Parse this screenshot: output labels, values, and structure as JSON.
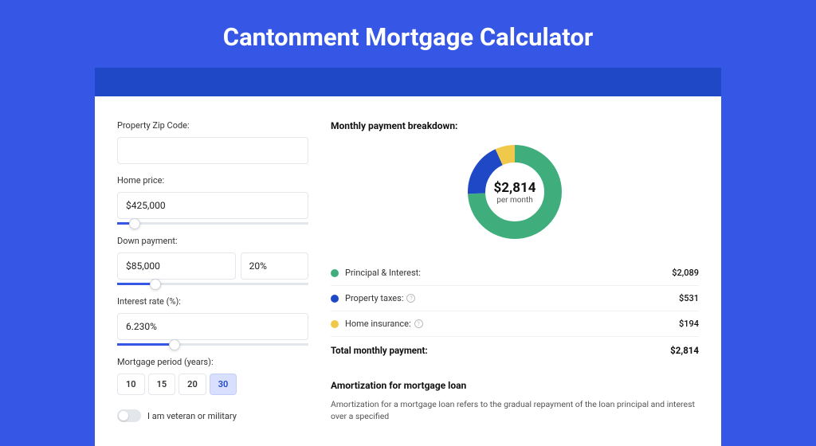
{
  "title": "Cantonment Mortgage Calculator",
  "form": {
    "zip": {
      "label": "Property Zip Code:",
      "value": ""
    },
    "homePrice": {
      "label": "Home price:",
      "value": "$425,000",
      "sliderPercent": 9
    },
    "downPayment": {
      "label": "Down payment:",
      "amount": "$85,000",
      "percent": "20%",
      "sliderPercent": 20
    },
    "interestRate": {
      "label": "Interest rate (%):",
      "value": "6.230%",
      "sliderPercent": 30
    },
    "period": {
      "label": "Mortgage period (years):",
      "options": [
        "10",
        "15",
        "20",
        "30"
      ],
      "selected": "30"
    },
    "veteran": {
      "label": "I am veteran or military"
    }
  },
  "breakdown": {
    "title": "Monthly payment breakdown:",
    "donut": {
      "amount": "$2,814",
      "sub": "per month"
    },
    "items": [
      {
        "color": "#3fae7c",
        "label": "Principal & Interest:",
        "value": "$2,089",
        "info": false
      },
      {
        "color": "#1f48c6",
        "label": "Property taxes:",
        "value": "$531",
        "info": true
      },
      {
        "color": "#f1c94a",
        "label": "Home insurance:",
        "value": "$194",
        "info": true
      }
    ],
    "totalLabel": "Total monthly payment:",
    "totalValue": "$2,814"
  },
  "amortization": {
    "title": "Amortization for mortgage loan",
    "text": "Amortization for a mortgage loan refers to the gradual repayment of the loan principal and interest over a specified"
  },
  "chart_data": {
    "type": "pie",
    "title": "Monthly payment breakdown",
    "total": 2814,
    "series": [
      {
        "name": "Principal & Interest",
        "value": 2089,
        "color": "#3fae7c"
      },
      {
        "name": "Property taxes",
        "value": 531,
        "color": "#1f48c6"
      },
      {
        "name": "Home insurance",
        "value": 194,
        "color": "#f1c94a"
      }
    ]
  }
}
